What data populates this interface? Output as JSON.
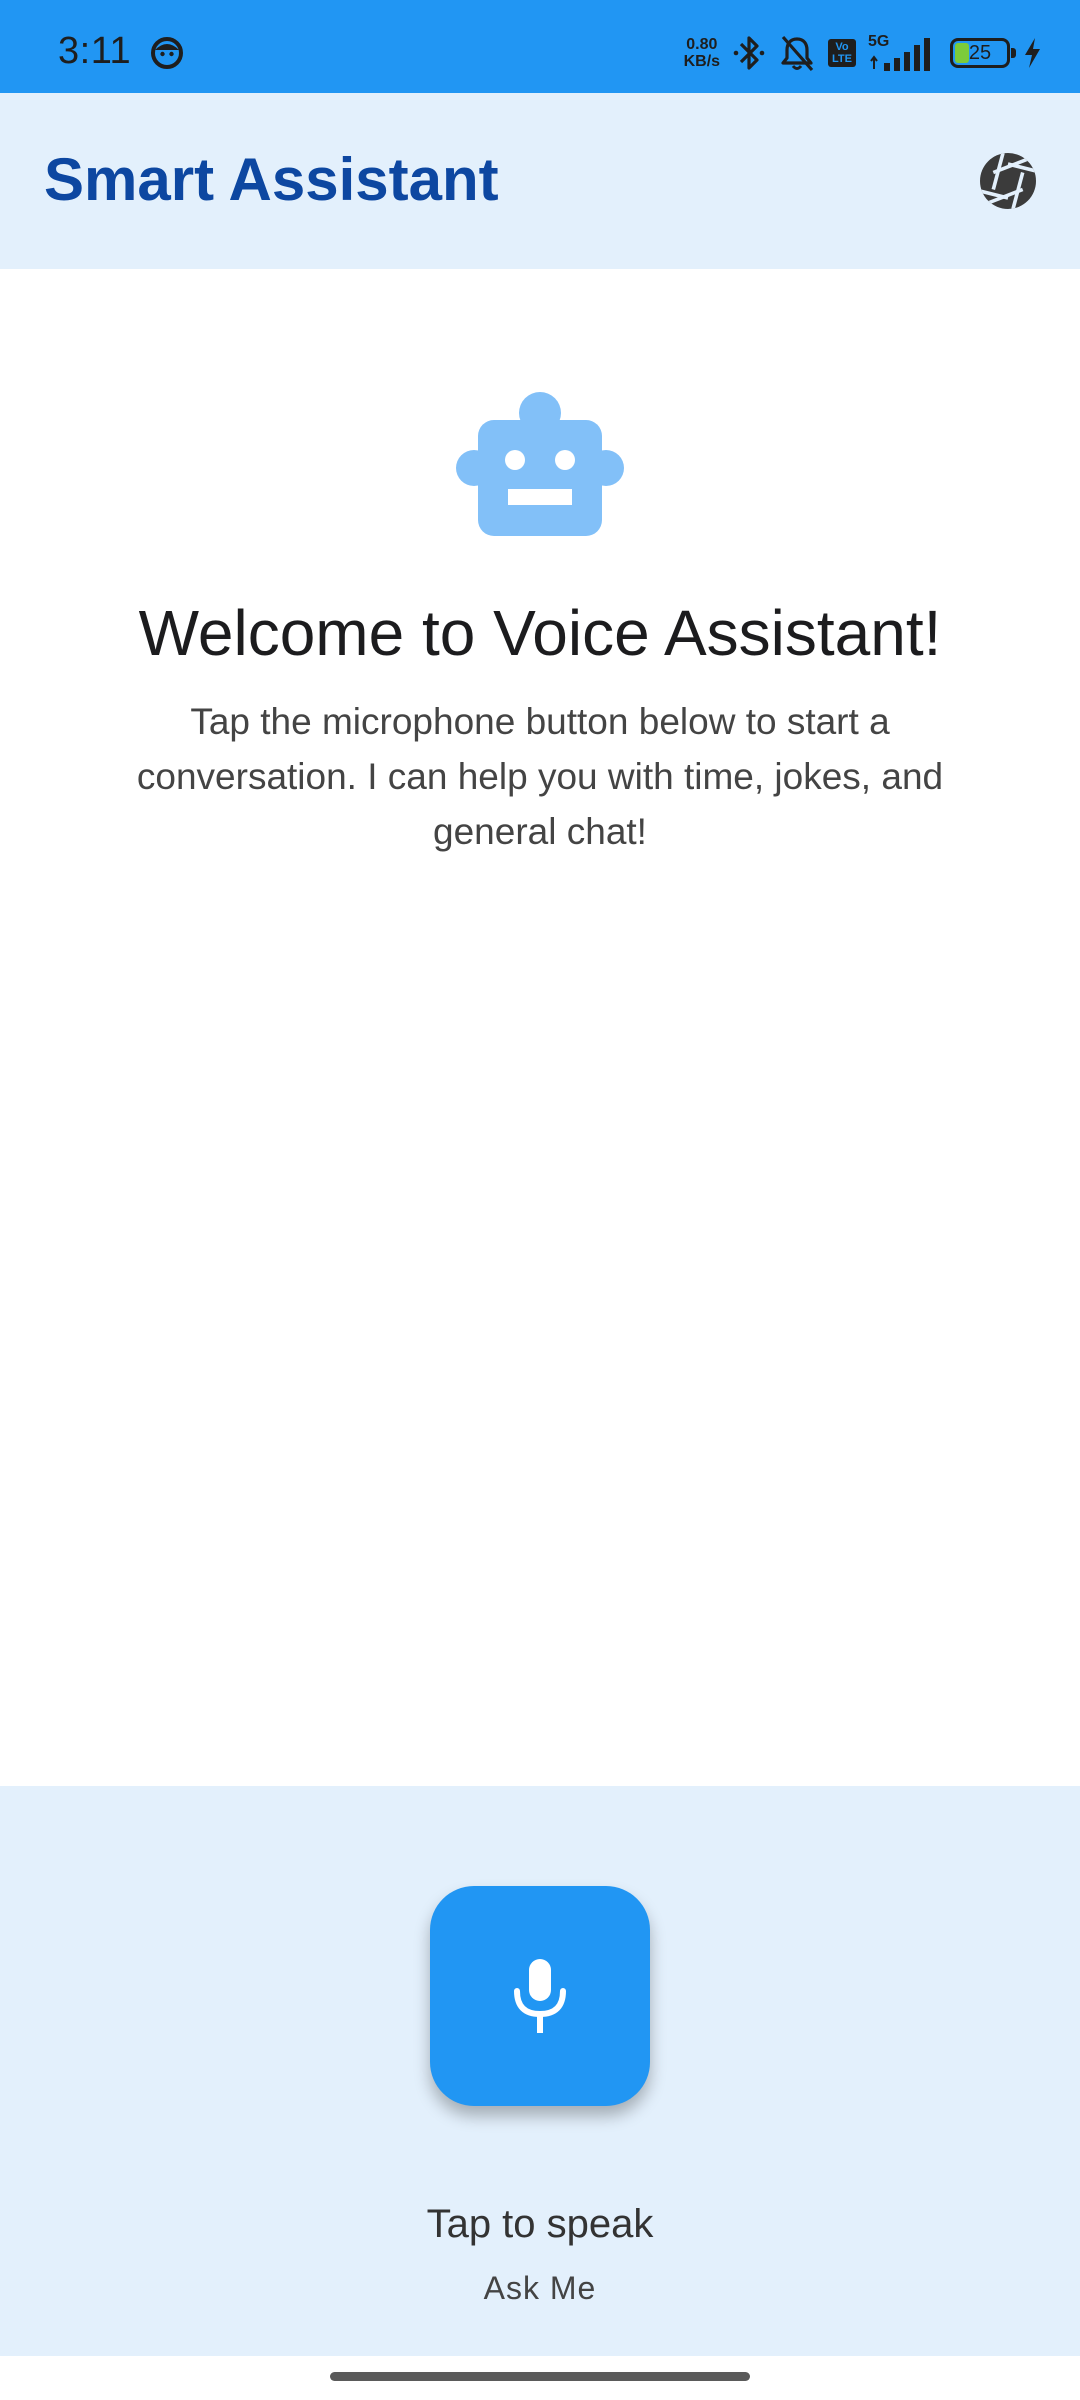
{
  "status_bar": {
    "time": "3:11",
    "net_speed_value": "0.80",
    "net_speed_unit": "KB/s",
    "volte_top": "Vo",
    "volte_bottom": "LTE",
    "network_type": "5G",
    "battery_level": "25",
    "icons": [
      "face-icon",
      "bluetooth-icon",
      "bell-off-icon",
      "volte-icon",
      "signal-icon",
      "battery-icon",
      "charging-icon"
    ]
  },
  "app_bar": {
    "title": "Smart Assistant",
    "settings_icon": "aperture-icon"
  },
  "welcome": {
    "icon": "robot-icon",
    "title": "Welcome to Voice Assistant!",
    "subtitle": "Tap the microphone button below to start a conversation. I can help you with time, jokes, and general chat!"
  },
  "voice_panel": {
    "mic_icon": "microphone-icon",
    "primary_label": "Tap to speak",
    "secondary_label": "Ask Me"
  },
  "colors": {
    "status_bar": "#2196F3",
    "app_bar_bg": "#E3F0FC",
    "title_color": "#0D47A1",
    "accent": "#2196F3",
    "robot_color": "#82C0F8"
  }
}
